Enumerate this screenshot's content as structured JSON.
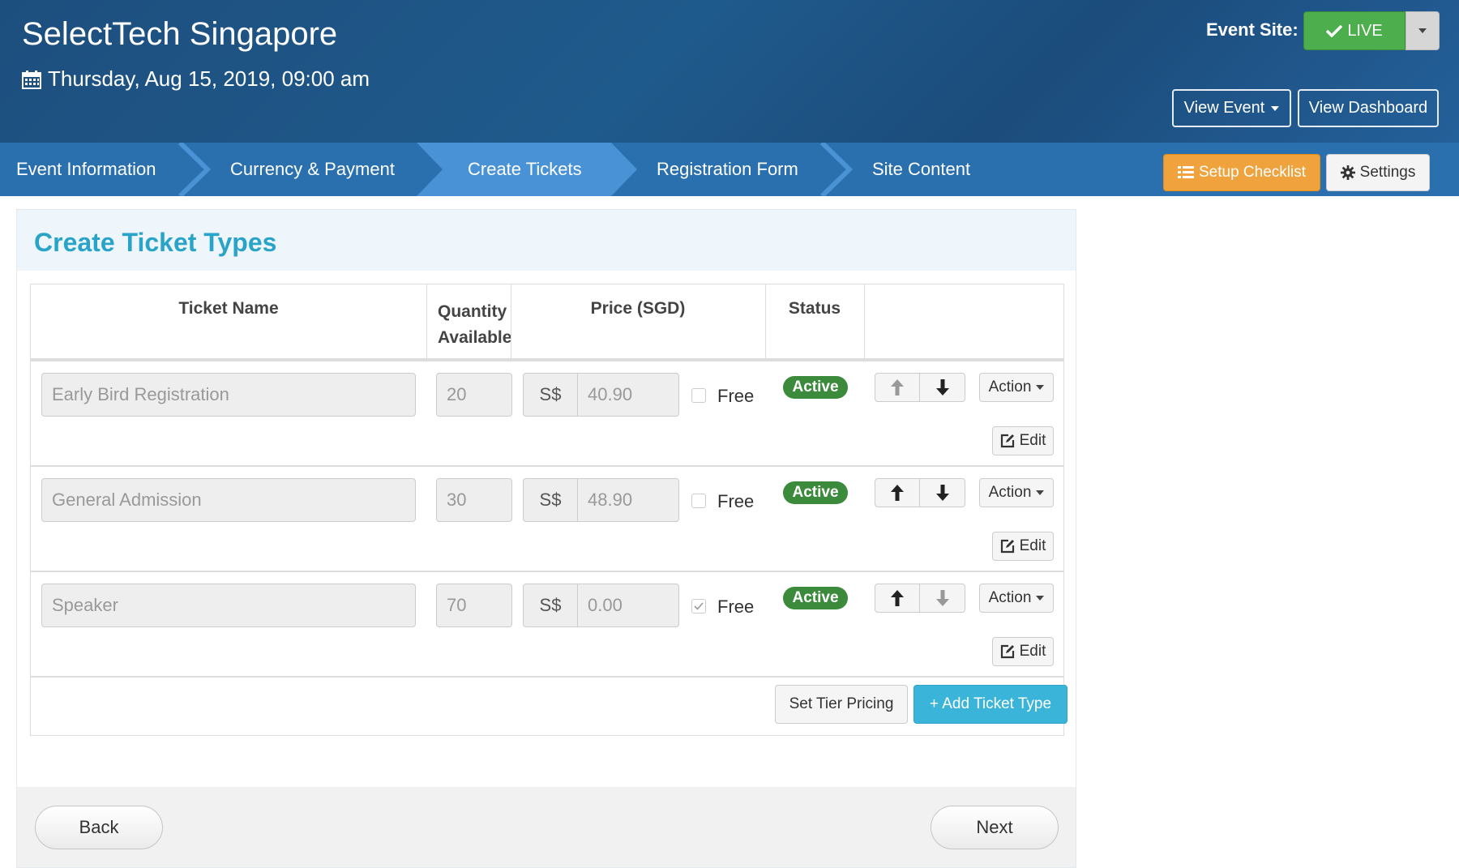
{
  "header": {
    "title": "SelectTech Singapore",
    "date": "Thursday, Aug 15, 2019, 09:00 am",
    "event_site_label": "Event Site:",
    "live_label": "LIVE",
    "view_event": "View Event",
    "view_dashboard": "View Dashboard"
  },
  "nav": {
    "steps": [
      {
        "label": "Event Information",
        "active": false
      },
      {
        "label": "Currency & Payment",
        "active": false
      },
      {
        "label": "Create Tickets",
        "active": true
      },
      {
        "label": "Registration Form",
        "active": false
      },
      {
        "label": "Site Content",
        "active": false
      }
    ],
    "setup_checklist": "Setup Checklist",
    "settings": "Settings"
  },
  "panel": {
    "title": "Create Ticket Types",
    "columns": {
      "ticket_name": "Ticket Name",
      "quantity_line1": "Quantity",
      "quantity_line2": "Available",
      "price": "Price (SGD)",
      "status": "Status"
    },
    "tickets": [
      {
        "name": "Early Bird Registration",
        "quantity": "20",
        "currency": "S$",
        "price": "40.90",
        "free": false,
        "free_label": "Free",
        "status": "Active",
        "up_disabled": true,
        "down_disabled": false,
        "action_label": "Action",
        "edit_label": "Edit"
      },
      {
        "name": "General Admission",
        "quantity": "30",
        "currency": "S$",
        "price": "48.90",
        "free": false,
        "free_label": "Free",
        "status": "Active",
        "up_disabled": false,
        "down_disabled": false,
        "action_label": "Action",
        "edit_label": "Edit"
      },
      {
        "name": "Speaker",
        "quantity": "70",
        "currency": "S$",
        "price": "0.00",
        "free": true,
        "free_label": "Free",
        "status": "Active",
        "up_disabled": false,
        "down_disabled": true,
        "action_label": "Action",
        "edit_label": "Edit"
      }
    ],
    "set_tier_pricing": "Set Tier Pricing",
    "add_ticket_type": "+ Add Ticket Type",
    "back": "Back",
    "next": "Next"
  },
  "colors": {
    "header_bg": "#1d4f7e",
    "nav_bg": "#2a6fae",
    "nav_active": "#4a92d6",
    "live_green": "#4cae4c",
    "checklist_orange": "#f0a33c",
    "title_cyan": "#2aa3c9",
    "badge_green": "#3c8a3c",
    "add_button_blue": "#3bb4da"
  },
  "icons": [
    "calendar-icon",
    "check-icon",
    "caret-down-icon",
    "list-icon",
    "gear-icon",
    "arrow-up-icon",
    "arrow-down-icon",
    "edit-icon"
  ]
}
